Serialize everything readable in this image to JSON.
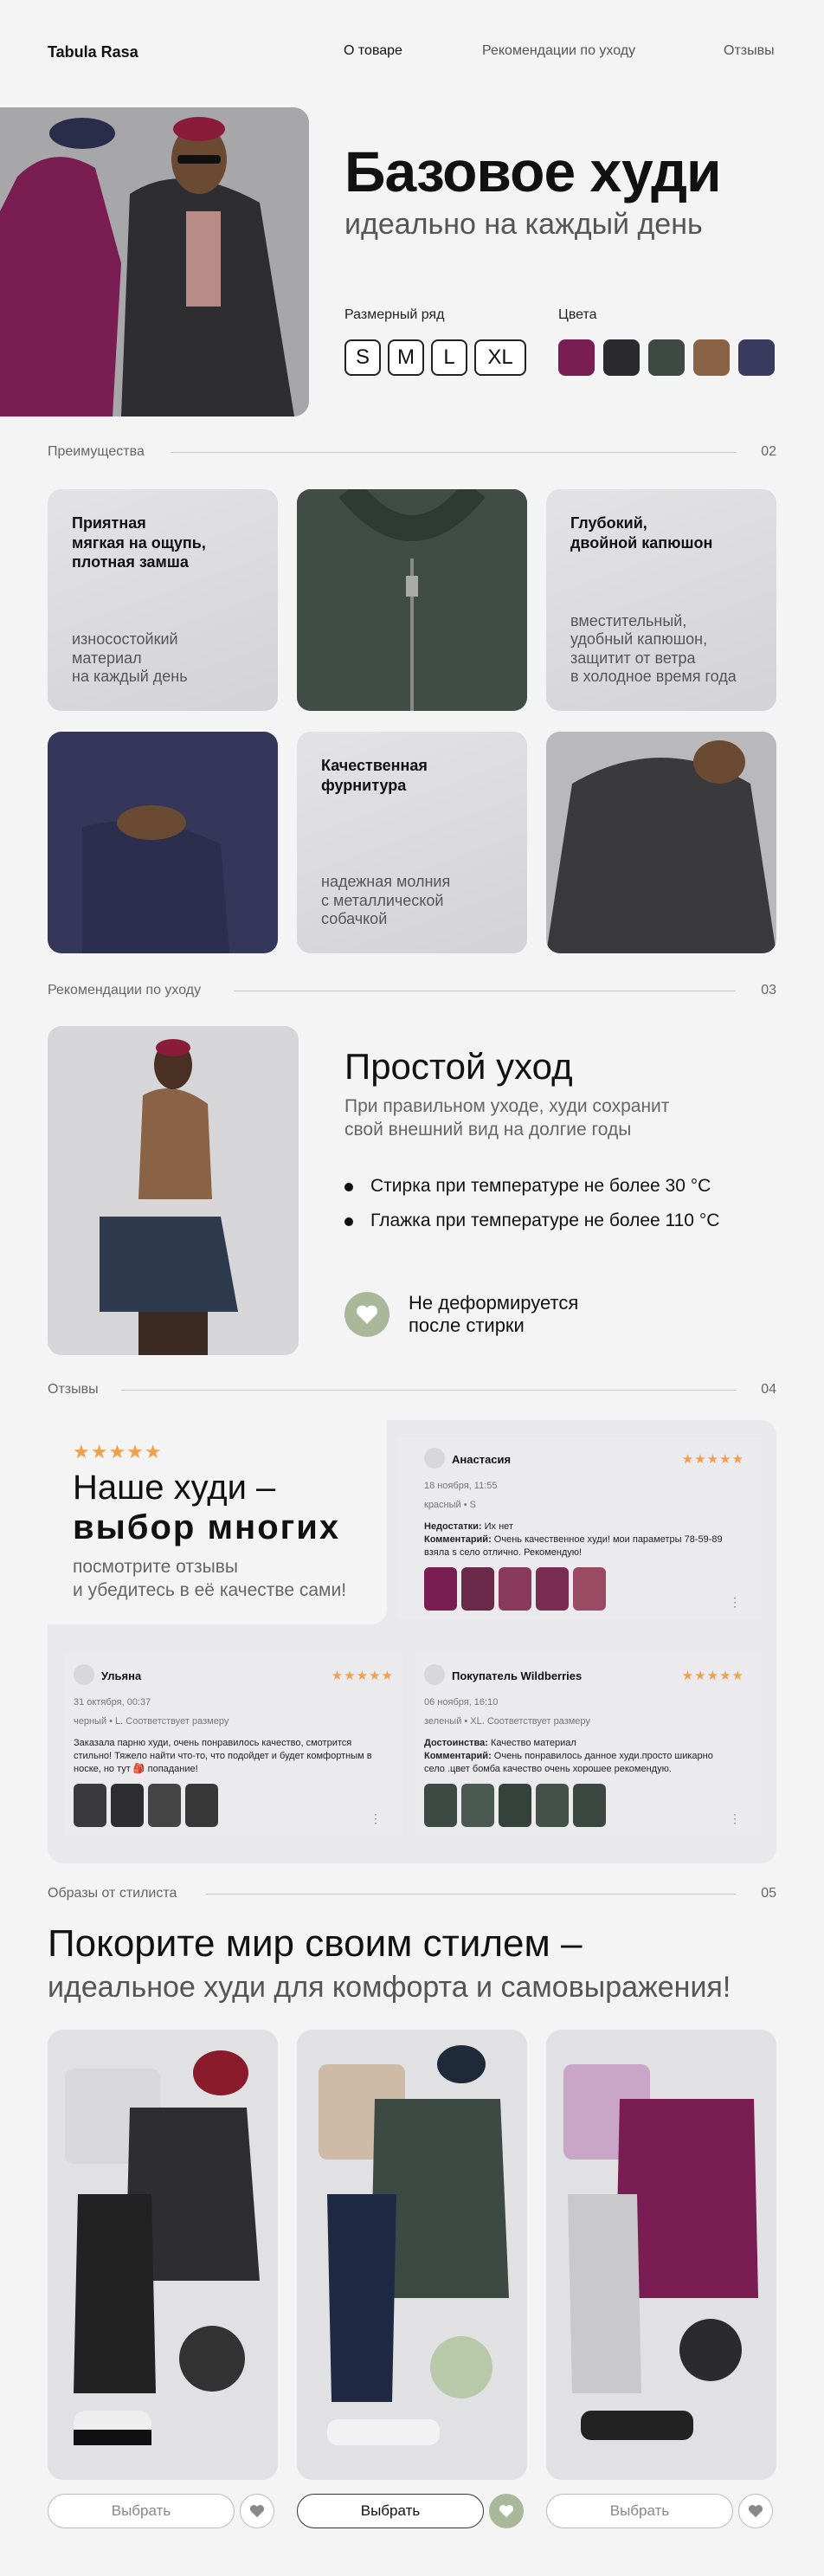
{
  "brand": "Tabula Rasa",
  "nav": [
    {
      "label": "О товаре"
    },
    {
      "label": "Рекомендации по уходу"
    },
    {
      "label": "Отзывы"
    }
  ],
  "hero": {
    "title": "Базовое худи",
    "subtitle": "идеально на каждый день",
    "sizes_label": "Размерный ряд",
    "sizes": [
      "S",
      "M",
      "L",
      "XL"
    ],
    "colors_label": "Цвета",
    "colors": [
      "#7a1d52",
      "#2b2b2e",
      "#3d4a43",
      "#8a6347",
      "#3a3a5e"
    ]
  },
  "advantages": {
    "label": "Преимущества",
    "num": "02",
    "cards": [
      {
        "title": "Приятная\nмягкая на ощупь,\nплотная замша",
        "desc": "износостойкий\nматериал\nна каждый день"
      },
      {
        "title": "Глубокий,\nдвойной капюшон",
        "desc": "вместительный,\nудобный капюшон,\nзащитит от ветра\nв холодное время года"
      },
      {
        "title": "Качественная\nфурнитура",
        "desc": "надежная молния\nс металлической\nсобачкой"
      }
    ]
  },
  "care": {
    "label": "Рекомендации по уходу",
    "num": "03",
    "title": "Простой уход",
    "subtitle": "При правильном уходе, худи сохранит\nсвой внешний вид на долгие годы",
    "bullets": [
      "Стирка при температуре не более 30 °С",
      "Глажка при температуре не более 110 °С"
    ],
    "badge": "Не деформируется\nпосле стирки"
  },
  "reviews": {
    "label": "Отзывы",
    "num": "04",
    "rating": "★★★★★",
    "headline1": "Наше худи –",
    "headline2": "выбор многих",
    "sub": "посмотрите отзывы\nи убедитесь в её качестве сами!",
    "items": [
      {
        "name": "Анастасия",
        "stars": "★★★★★",
        "date": "18 ноября, 11:55",
        "meta": "красный • S",
        "text1_label": "Недостатки:",
        "text1": " Их нет",
        "text2_label": "Комментарий:",
        "text2": " Очень качественное худи! мои параметры 78-59-89 взяла s село отлично. Рекомендую!"
      },
      {
        "name": "Ульяна",
        "stars": "★★★★★",
        "date": "31 октября, 00:37",
        "meta": "черный • L. Соответствует размеру",
        "text": "Заказала парню худи, очень понравилось качество, смотрится стильно! Тяжело найти что-то, что подойдет и будет комфортным в носке, но тут 🎒 попадание!"
      },
      {
        "name": "Покупатель Wildberries",
        "stars": "★★★★★",
        "date": "06 ноября, 16:10",
        "meta": "зеленый • XL. Соответствует размеру",
        "text1_label": "Достоинства:",
        "text1": " Качество материал",
        "text2_label": "Комментарий:",
        "text2": " Очень понравилось данное худи.просто шикарно село .цвет бомба качество очень хорошее рекомендую."
      }
    ]
  },
  "stylist": {
    "label": "Образы от стилиста",
    "num": "05",
    "title": "Покорите мир своим стилем –",
    "subtitle": "идеальное худи для комфорта и самовыражения!",
    "buttons": [
      "Выбрать",
      "Выбрать",
      "Выбрать"
    ]
  }
}
